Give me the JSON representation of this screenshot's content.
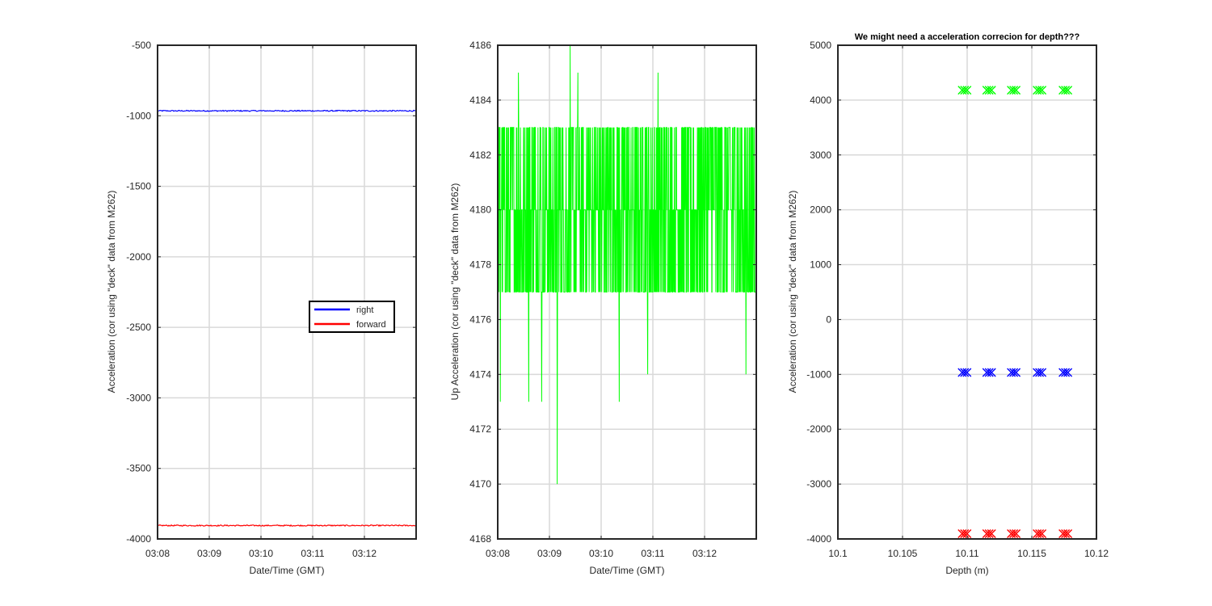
{
  "chart_data": [
    {
      "type": "line",
      "xlabel": "Date/Time (GMT)",
      "ylabel": "Acceleration (cor using \"deck\" data from M262)",
      "title": "",
      "xlim": [
        "03:08",
        "03:13"
      ],
      "ylim": [
        -4000,
        -500
      ],
      "x_ticks": [
        "03:08",
        "03:09",
        "03:10",
        "03:11",
        "03:12"
      ],
      "y_ticks": [
        -500,
        -1000,
        -1500,
        -2000,
        -2500,
        -3000,
        -3500,
        -4000
      ],
      "grid": true,
      "legend": {
        "placement": "center-right",
        "entries": [
          "right",
          "forward"
        ]
      },
      "series": [
        {
          "name": "right",
          "color": "#0000ff",
          "approx_value": -965,
          "noise": 4
        },
        {
          "name": "forward",
          "color": "#ff0000",
          "approx_value": -3905,
          "noise": 4
        }
      ]
    },
    {
      "type": "line",
      "xlabel": "Date/Time (GMT)",
      "ylabel": "Up Acceleration (cor using \"deck\" data from M262)",
      "title": "",
      "xlim": [
        "03:08",
        "03:13"
      ],
      "ylim": [
        4168,
        4186
      ],
      "x_ticks": [
        "03:08",
        "03:09",
        "03:10",
        "03:11",
        "03:12"
      ],
      "y_ticks": [
        4186,
        4184,
        4182,
        4180,
        4178,
        4176,
        4174,
        4172,
        4170,
        4168
      ],
      "grid": true,
      "series": [
        {
          "color": "#00ff00",
          "levels": [
            4177,
            4180,
            4183
          ],
          "spikes": [
            {
              "x": "03:08.05",
              "y": 4173
            },
            {
              "x": "03:08.4",
              "y": 4185
            },
            {
              "x": "03:08.6",
              "y": 4173
            },
            {
              "x": "03:08.85",
              "y": 4173
            },
            {
              "x": "03:09.15",
              "y": 4170
            },
            {
              "x": "03:09.4",
              "y": 4186
            },
            {
              "x": "03:09.55",
              "y": 4185
            },
            {
              "x": "03:10.35",
              "y": 4173
            },
            {
              "x": "03:10.9",
              "y": 4174
            },
            {
              "x": "03:11.1",
              "y": 4185
            },
            {
              "x": "03:12.8",
              "y": 4174
            }
          ]
        }
      ]
    },
    {
      "type": "scatter",
      "title": "We might need a acceleration correcion for depth???",
      "xlabel": "Depth (m)",
      "ylabel": "Acceleration (cor using \"deck\" data from M262)",
      "xlim": [
        10.1,
        10.12
      ],
      "ylim": [
        -4000,
        5000
      ],
      "x_ticks": [
        "10.1",
        "10.105",
        "10.11",
        "10.115",
        "10.12"
      ],
      "y_ticks": [
        5000,
        4000,
        3000,
        2000,
        1000,
        0,
        -1000,
        -2000,
        -3000,
        -4000
      ],
      "grid": true,
      "marker": "x",
      "x_values": [
        10.1098,
        10.1117,
        10.1136,
        10.1156,
        10.1176
      ],
      "series": [
        {
          "color": "#00ff00",
          "values": [
            4180,
            4180,
            4180,
            4180,
            4180
          ]
        },
        {
          "color": "#0000ff",
          "values": [
            -965,
            -965,
            -965,
            -965,
            -965
          ]
        },
        {
          "color": "#ff0000",
          "values": [
            -3905,
            -3905,
            -3905,
            -3905,
            -3905
          ]
        }
      ]
    }
  ]
}
